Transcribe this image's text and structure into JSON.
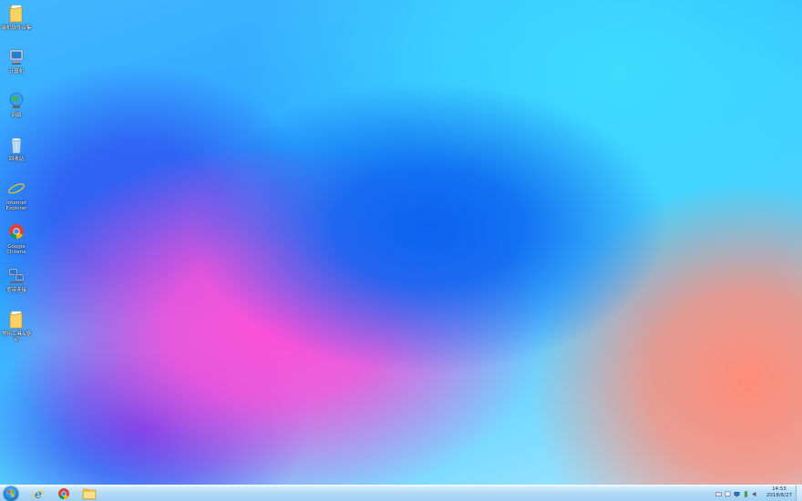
{
  "desktop": {
    "icons": [
      {
        "label": "装机软件合集",
        "icon": "folder-icon"
      },
      {
        "label": "计算机",
        "icon": "computer-icon"
      },
      {
        "label": "网络",
        "icon": "network-icon"
      },
      {
        "label": "回收站",
        "icon": "recycle-bin-icon"
      },
      {
        "label": "Internet Explorer",
        "icon": "internet-explorer-icon"
      },
      {
        "label": "Google Chrome",
        "icon": "chrome-icon"
      },
      {
        "label": "宽带连接",
        "icon": "broadband-connection-icon"
      },
      {
        "label": "常用工具&驱动",
        "icon": "folder-icon"
      }
    ]
  },
  "taskbar": {
    "pinned": [
      {
        "name": "Internet Explorer",
        "icon": "internet-explorer-icon"
      },
      {
        "name": "Google Chrome",
        "icon": "chrome-icon"
      },
      {
        "name": "Windows Explorer",
        "icon": "folder-icon"
      }
    ],
    "tray": [
      "keyboard-icon",
      "action-center-icon",
      "network-tray-icon",
      "power-icon",
      "volume-icon"
    ],
    "clock": {
      "time": "14:53",
      "date": "2018/6/27"
    }
  },
  "colors": {
    "taskbar": "#b4dcf8",
    "accent": "#1d7fd6"
  }
}
